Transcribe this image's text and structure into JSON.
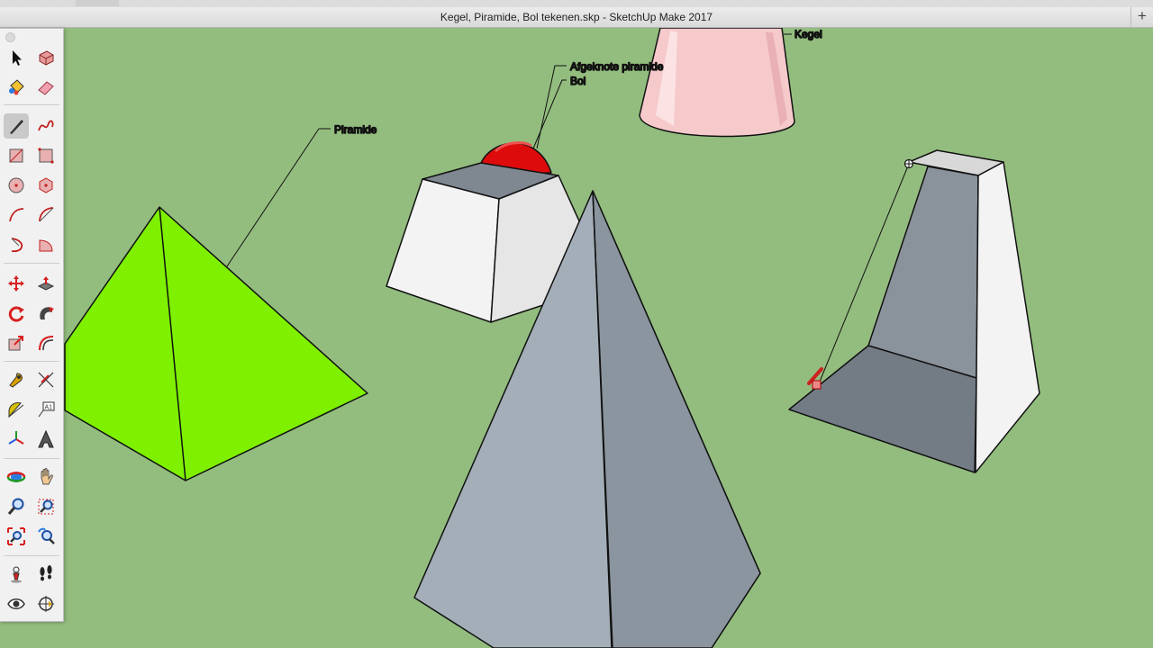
{
  "window": {
    "title": "Kegel, Piramide, Bol tekenen.skp - SketchUp Make 2017"
  },
  "scene": {
    "labels": {
      "piramide": "Piramide",
      "afgeknote": "Afgeknote piramide",
      "bol": "Bol",
      "kegel": "Kegel"
    },
    "colors": {
      "ground": "#93bd7f",
      "green_pyramid": "#7ef000",
      "sphere": "#dd0b0b",
      "cone": "#f6c9cb",
      "gray_face": "#a3aeb8",
      "dark_face": "#737b85",
      "white_face": "#f3f3f3"
    }
  },
  "toolbar": {
    "tools": [
      {
        "name": "select-tool",
        "label": "Select"
      },
      {
        "name": "make-component-tool",
        "label": "Make Component"
      },
      {
        "name": "paint-bucket-tool",
        "label": "Paint Bucket"
      },
      {
        "name": "eraser-tool",
        "label": "Eraser"
      },
      {
        "name": "line-tool",
        "label": "Line",
        "active": true
      },
      {
        "name": "freehand-tool",
        "label": "Freehand"
      },
      {
        "name": "rectangle-tool",
        "label": "Rectangle"
      },
      {
        "name": "rotated-rectangle-tool",
        "label": "Rotated Rectangle"
      },
      {
        "name": "circle-tool",
        "label": "Circle"
      },
      {
        "name": "polygon-tool",
        "label": "Polygon"
      },
      {
        "name": "arc-tool",
        "label": "Arc"
      },
      {
        "name": "two-point-arc-tool",
        "label": "2 Point Arc"
      },
      {
        "name": "three-point-arc-tool",
        "label": "3 Point Arc"
      },
      {
        "name": "pie-tool",
        "label": "Pie"
      },
      {
        "name": "move-tool",
        "label": "Move"
      },
      {
        "name": "push-pull-tool",
        "label": "Push/Pull"
      },
      {
        "name": "rotate-tool",
        "label": "Rotate"
      },
      {
        "name": "follow-me-tool",
        "label": "Follow Me"
      },
      {
        "name": "scale-tool",
        "label": "Scale"
      },
      {
        "name": "offset-tool",
        "label": "Offset"
      },
      {
        "name": "tape-measure-tool",
        "label": "Tape Measure"
      },
      {
        "name": "dimension-tool",
        "label": "Dimension"
      },
      {
        "name": "protractor-tool",
        "label": "Protractor"
      },
      {
        "name": "text-tool",
        "label": "Text"
      },
      {
        "name": "axes-tool",
        "label": "Axes"
      },
      {
        "name": "3d-text-tool",
        "label": "3D Text"
      },
      {
        "name": "orbit-tool",
        "label": "Orbit"
      },
      {
        "name": "pan-tool",
        "label": "Pan"
      },
      {
        "name": "zoom-tool",
        "label": "Zoom"
      },
      {
        "name": "zoom-window-tool",
        "label": "Zoom Window"
      },
      {
        "name": "zoom-extents-tool",
        "label": "Zoom Extents"
      },
      {
        "name": "previous-view-tool",
        "label": "Previous"
      },
      {
        "name": "position-camera-tool",
        "label": "Position Camera"
      },
      {
        "name": "walk-tool",
        "label": "Walk"
      },
      {
        "name": "look-around-tool",
        "label": "Look Around"
      },
      {
        "name": "section-plane-tool",
        "label": "Section Plane"
      }
    ]
  }
}
